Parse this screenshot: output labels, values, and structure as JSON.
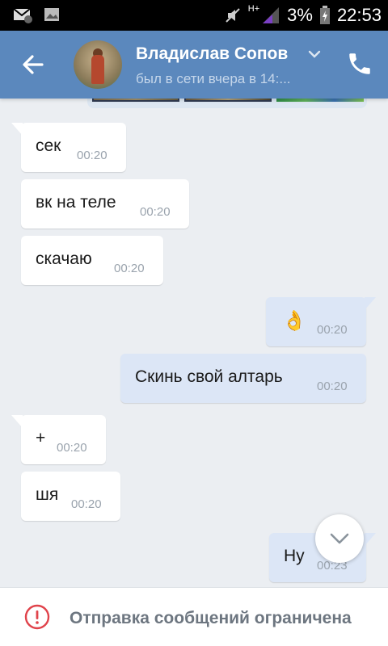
{
  "status_bar": {
    "battery": "3%",
    "time": "22:53",
    "network": "H+"
  },
  "header": {
    "contact_name": "Владислав Сопов",
    "contact_status": "был в сети вчера в 14:..."
  },
  "messages": [
    {
      "direction": "in",
      "text": "сек",
      "time": "00:20"
    },
    {
      "direction": "in",
      "text": "вк на теле",
      "time": "00:20"
    },
    {
      "direction": "in",
      "text": "скачаю",
      "time": "00:20"
    },
    {
      "direction": "out",
      "text": "👌",
      "time": "00:20"
    },
    {
      "direction": "out",
      "text": "Скинь свой алтарь",
      "time": "00:20"
    },
    {
      "direction": "in",
      "text": "+",
      "time": "00:20"
    },
    {
      "direction": "in",
      "text": "шя",
      "time": "00:20"
    },
    {
      "direction": "out",
      "text": "Ну",
      "time": "00:23"
    }
  ],
  "footer": {
    "notice": "Отправка сообщений ограничена"
  },
  "colors": {
    "header_bg": "#5b88bd",
    "outgoing_bubble": "#dce6f6",
    "incoming_bubble": "#ffffff",
    "chat_bg": "#ebeef2",
    "warning": "#e0434b"
  },
  "icons": {
    "back": "back-arrow-icon",
    "call": "phone-icon",
    "scroll": "chevron-down-icon",
    "warning": "alert-circle-icon"
  }
}
